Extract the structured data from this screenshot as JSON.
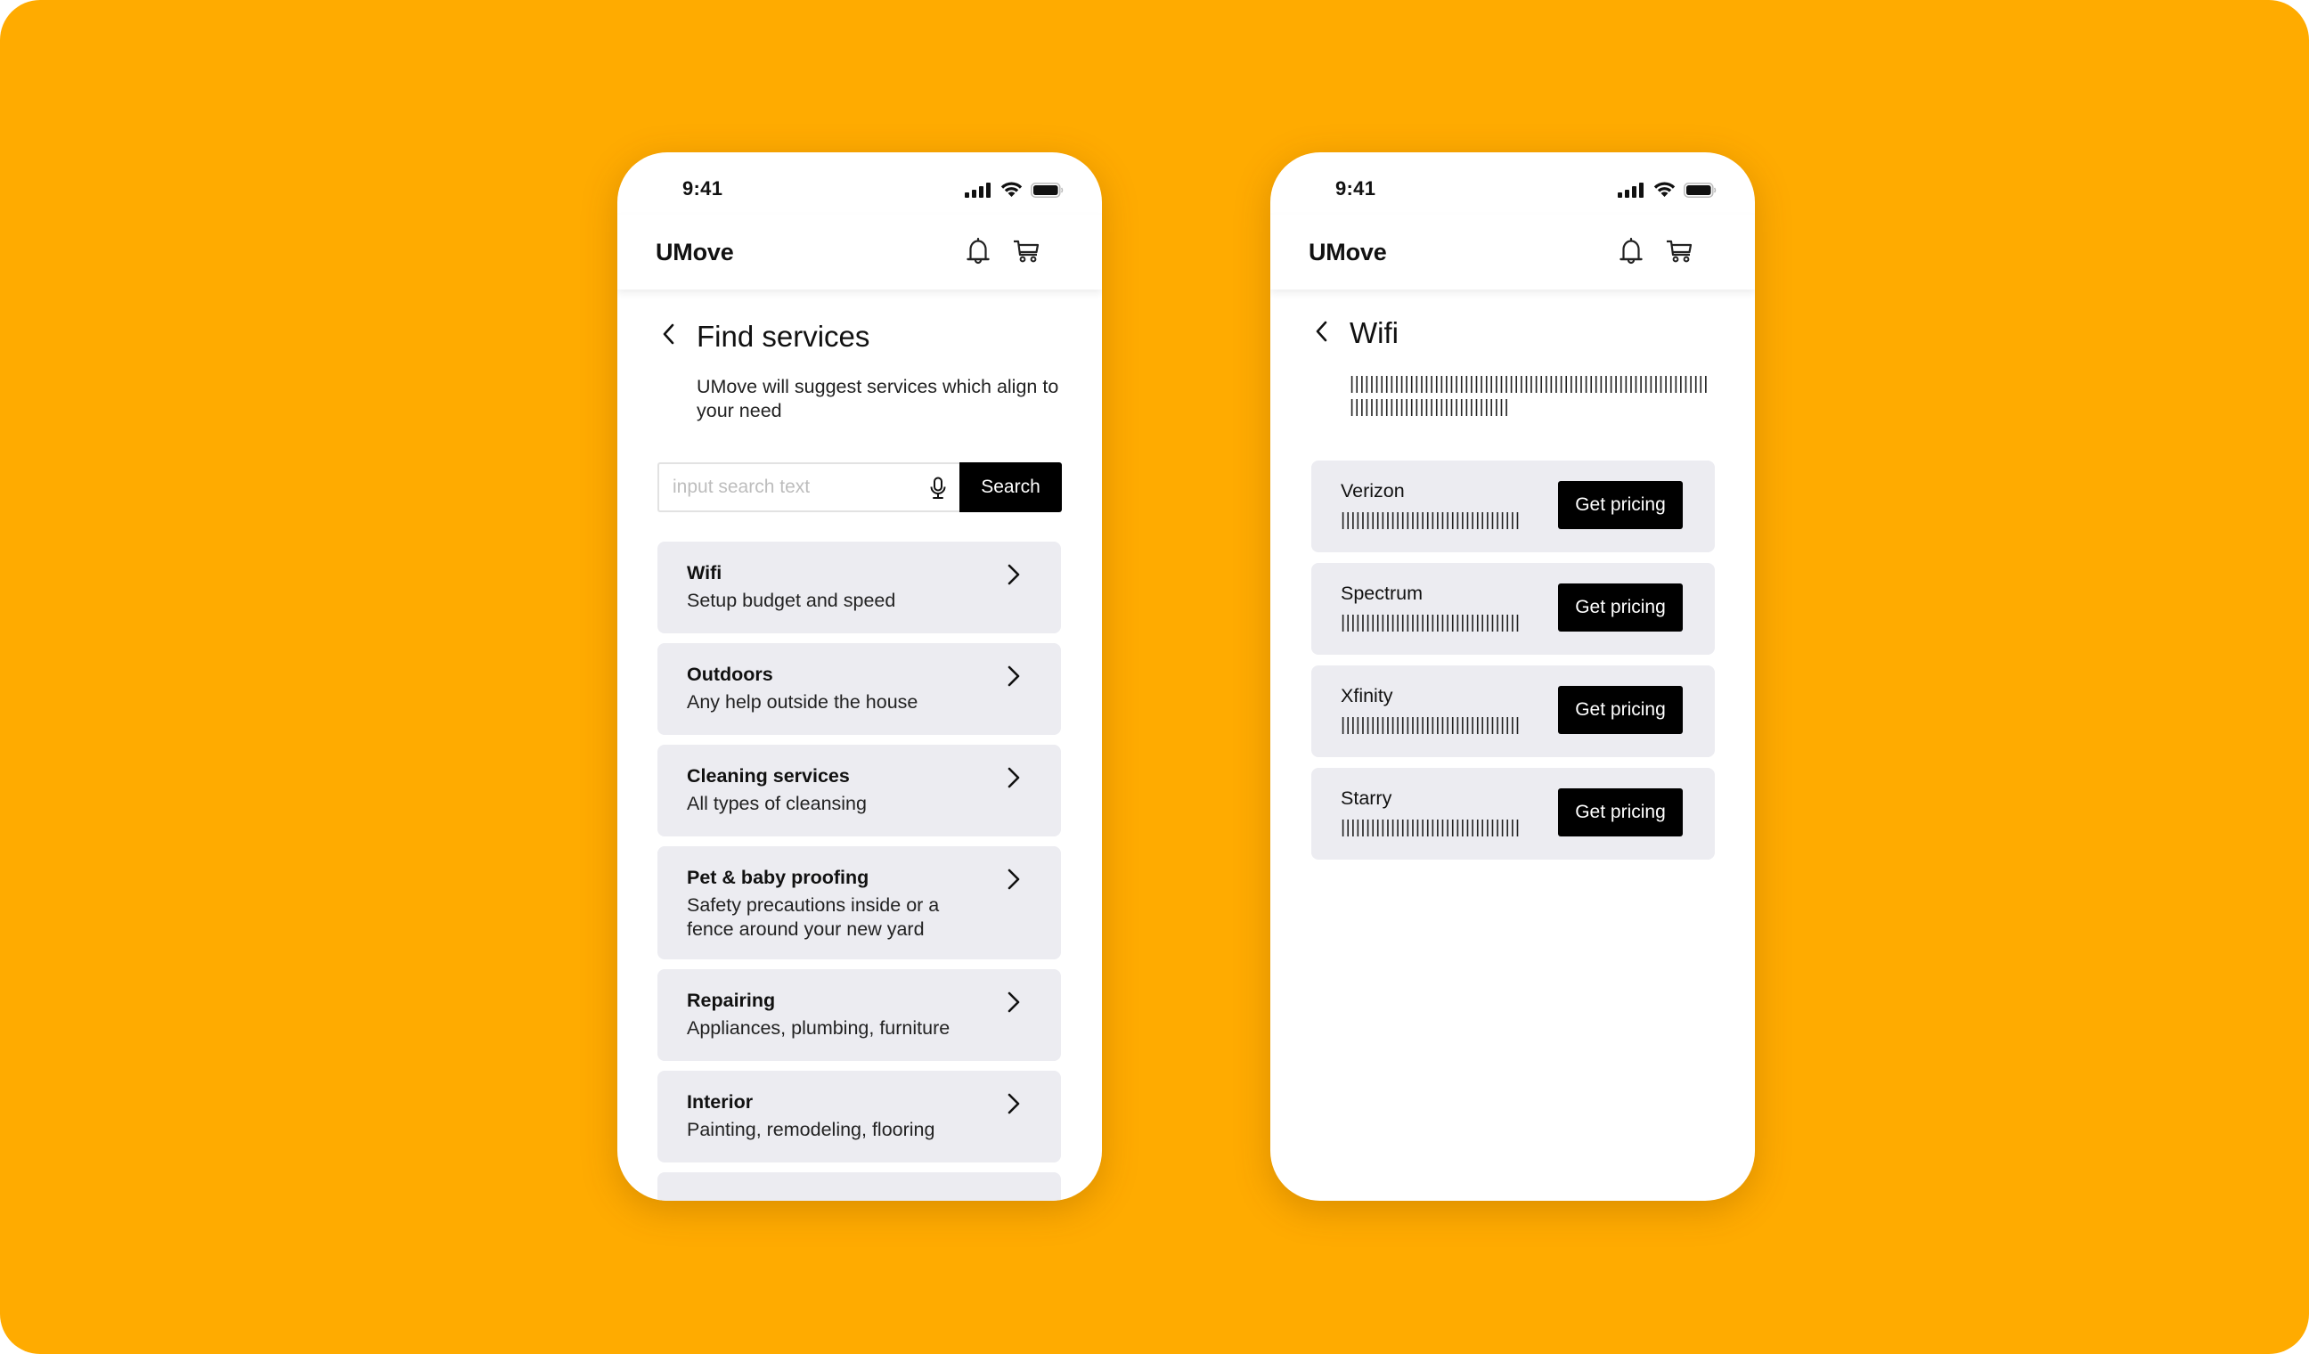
{
  "colors": {
    "background": "#FFAB00",
    "card": "#ECECF1",
    "button": "#000000",
    "button_text": "#FFFFFF"
  },
  "left_phone": {
    "status": {
      "time": "9:41",
      "icons": [
        "cellular-signal-icon",
        "wifi-icon",
        "battery-icon"
      ]
    },
    "header": {
      "brand": "UMove",
      "icons": [
        "bell-icon",
        "cart-icon"
      ]
    },
    "page": {
      "title": "Find services",
      "subtitle": "UMove will suggest services which align to your need"
    },
    "search": {
      "placeholder": "input search text",
      "value": "",
      "button_label": "Search"
    },
    "services": [
      {
        "title": "Wifi",
        "description": "Setup budget and speed"
      },
      {
        "title": "Outdoors",
        "description": "Any help outside the house"
      },
      {
        "title": "Cleaning services",
        "description": "All types of cleansing"
      },
      {
        "title": "Pet & baby proofing",
        "description": "Safety precautions inside or a fence around your new yard"
      },
      {
        "title": "Repairing",
        "description": "Appliances, plumbing, furniture"
      },
      {
        "title": "Interior",
        "description": "Painting, remodeling, flooring"
      }
    ]
  },
  "right_phone": {
    "status": {
      "time": "9:41",
      "icons": [
        "cellular-signal-icon",
        "wifi-icon",
        "battery-icon"
      ]
    },
    "header": {
      "brand": "UMove",
      "icons": [
        "bell-icon",
        "cart-icon"
      ]
    },
    "page": {
      "title": "Wifi",
      "subtitle": "||||||||||||||||||||||||||||||||||||||||||||||||||||||||||||||||||||||||||||||||||||||||||||||||||||||||"
    },
    "providers": [
      {
        "name": "Verizon",
        "detail": "||||||||||||||||||||||||||||||||||||",
        "button_label": "Get pricing"
      },
      {
        "name": "Spectrum",
        "detail": "||||||||||||||||||||||||||||||||||||",
        "button_label": "Get pricing"
      },
      {
        "name": "Xfinity",
        "detail": "||||||||||||||||||||||||||||||||||||",
        "button_label": "Get pricing"
      },
      {
        "name": "Starry",
        "detail": "||||||||||||||||||||||||||||||||||||",
        "button_label": "Get pricing"
      }
    ]
  }
}
